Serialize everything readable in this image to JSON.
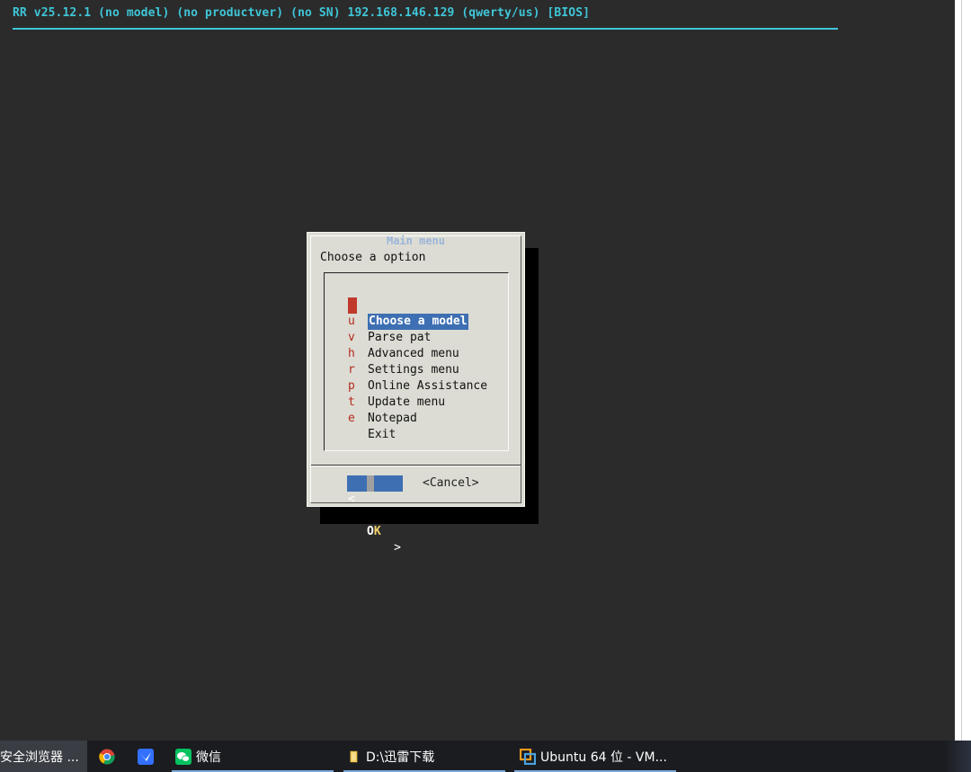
{
  "header": {
    "status_line": "RR v25.12.1 (no model) (no productver) (no SN) 192.168.146.129 (qwerty/us) [BIOS]"
  },
  "dialog": {
    "title": "Main menu",
    "prompt": "Choose a option",
    "menu": [
      {
        "key": "m",
        "label": "Choose a model",
        "selected": true
      },
      {
        "key": "u",
        "label": "Parse pat",
        "selected": false
      },
      {
        "key": "v",
        "label": "Advanced menu",
        "selected": false
      },
      {
        "key": "h",
        "label": "Settings menu",
        "selected": false
      },
      {
        "key": "r",
        "label": "Online Assistance",
        "selected": false
      },
      {
        "key": "p",
        "label": "Update menu",
        "selected": false
      },
      {
        "key": "t",
        "label": "Notepad",
        "selected": false
      },
      {
        "key": "e",
        "label": "Exit",
        "selected": false
      }
    ],
    "ok_left": "<",
    "ok_label_o": "O",
    "ok_label_k": "K",
    "ok_right": ">",
    "cancel_label": "<Cancel>"
  },
  "taskbar": {
    "items": [
      {
        "label": "安全浏览器 ...",
        "icon": "browser-icon"
      },
      {
        "label": "",
        "icon": "chrome-icon"
      },
      {
        "label": "",
        "icon": "feishu-icon"
      },
      {
        "label": "微信",
        "icon": "wechat-icon"
      },
      {
        "label": "D:\\迅雷下载",
        "icon": "folder-icon"
      },
      {
        "label": "Ubuntu 64 位 - VM...",
        "icon": "vmware-icon"
      }
    ]
  },
  "colors": {
    "header_text": "#3fc6d8",
    "menu_key": "#b52a1e",
    "selection": "#3e6fb3",
    "dialog_bg": "#dcdcd4",
    "screen_bg": "#2b2b2b"
  }
}
